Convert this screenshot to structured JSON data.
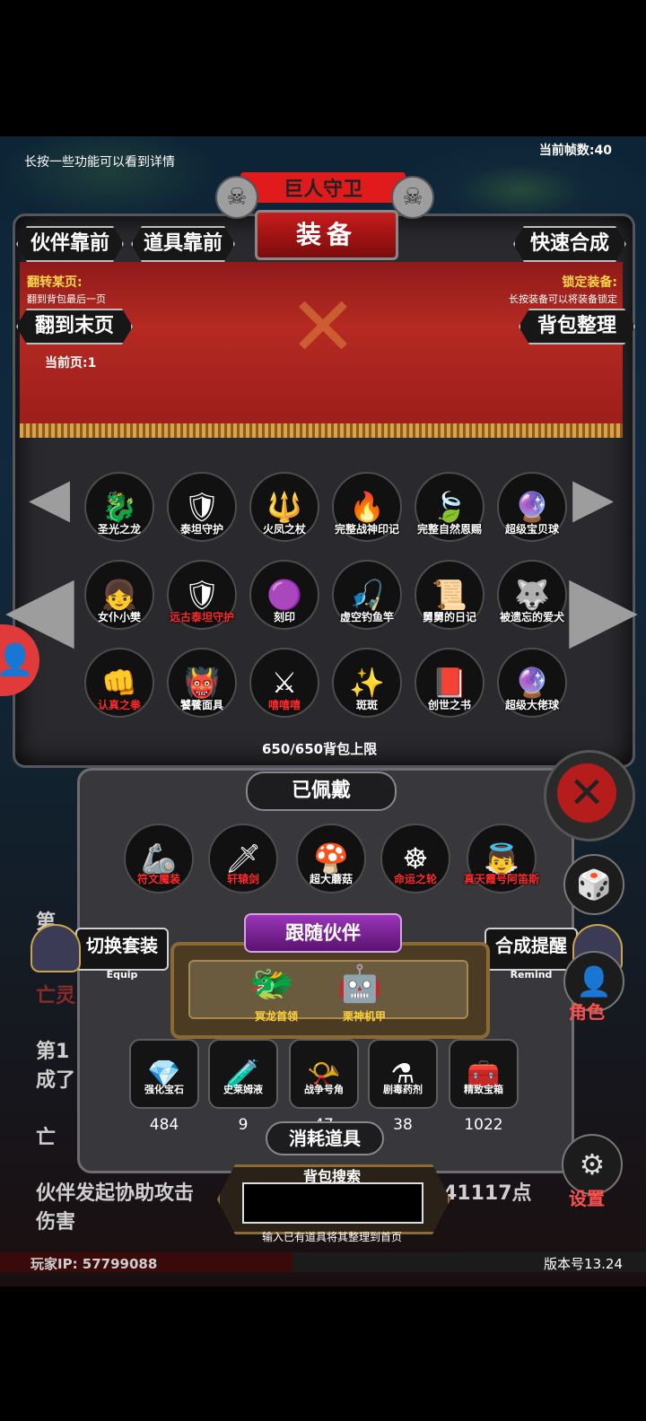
{
  "hint": "长按一些功能可以看到详情",
  "fps": "当前帧数:40",
  "title_top": "巨人守卫",
  "title_main": "装备",
  "buttons": {
    "partner_front": "伙伴靠前",
    "item_front": "道具靠前",
    "quick_synth": "快速合成",
    "last_page": "翻到末页",
    "bag_sort": "背包整理"
  },
  "flip": {
    "title": "翻转某页:",
    "desc": "翻到背包最后一页"
  },
  "lock": {
    "title": "锁定装备:",
    "desc": "长按装备可以将装备锁定"
  },
  "current_page": "当前页:1",
  "items": [
    {
      "name": "圣光之龙",
      "icon": "🐉",
      "color": "white"
    },
    {
      "name": "泰坦守护",
      "icon": "🛡",
      "color": "white"
    },
    {
      "name": "火凤之杖",
      "icon": "🔱",
      "color": "white"
    },
    {
      "name": "完整战神印记",
      "icon": "🔥",
      "color": "white"
    },
    {
      "name": "完整自然恩赐",
      "icon": "🍃",
      "color": "white"
    },
    {
      "name": "超级宝贝球",
      "icon": "🔮",
      "color": "white"
    },
    {
      "name": "女仆小樊",
      "icon": "👧",
      "color": "white"
    },
    {
      "name": "远古泰坦守护",
      "icon": "🛡",
      "color": "red"
    },
    {
      "name": "刻印",
      "icon": "🟣",
      "color": "white"
    },
    {
      "name": "虚空钓鱼竿",
      "icon": "🎣",
      "color": "white"
    },
    {
      "name": "舅舅的日记",
      "icon": "📜",
      "color": "white"
    },
    {
      "name": "被遗忘的爱犬",
      "icon": "🐺",
      "color": "white"
    },
    {
      "name": "认真之拳",
      "icon": "👊",
      "color": "red"
    },
    {
      "name": "饕餮面具",
      "icon": "👹",
      "color": "white"
    },
    {
      "name": "嘻嘻嘻",
      "icon": "⚔",
      "color": "red"
    },
    {
      "name": "斑斑",
      "icon": "✨",
      "color": "white"
    },
    {
      "name": "创世之书",
      "icon": "📕",
      "color": "white"
    },
    {
      "name": "超级大佬球",
      "icon": "🔮",
      "color": "white"
    }
  ],
  "capacity": "650/650背包上限",
  "equipped_title": "已佩戴",
  "equipped": [
    {
      "name": "符文魔装",
      "icon": "🦾",
      "color": "red"
    },
    {
      "name": "轩辕剑",
      "icon": "🗡",
      "color": "red"
    },
    {
      "name": "超大蘑菇",
      "icon": "🍄",
      "color": "white"
    },
    {
      "name": "命运之轮",
      "icon": "☸",
      "color": "red"
    },
    {
      "name": "真天霞号阿笛斯",
      "icon": "👼",
      "color": "red"
    }
  ],
  "switch_set": {
    "label": "切换套装",
    "sub": "Equip"
  },
  "synth_remind": {
    "label": "合成提醒",
    "sub": "Remind"
  },
  "companion_title": "跟随伙伴",
  "companions": [
    {
      "name": "冥龙首领",
      "icon": "🐲"
    },
    {
      "name": "栗神机甲",
      "icon": "🤖"
    }
  ],
  "consumables": [
    {
      "name": "强化宝石",
      "count": "484",
      "icon": "💎"
    },
    {
      "name": "史莱姆液",
      "count": "9",
      "icon": "🧪"
    },
    {
      "name": "战争号角",
      "count": "47",
      "icon": "📯"
    },
    {
      "name": "剧毒药剂",
      "count": "38",
      "icon": "⚗"
    },
    {
      "name": "精致宝箱",
      "count": "1022",
      "icon": "🧰"
    }
  ],
  "consumables_title": "消耗道具",
  "search": {
    "title": "背包搜索",
    "hint": "输入已有道具将其整理到首页",
    "value": ""
  },
  "log_lines": [
    "第",
    "亡灵",
    "第1",
    "成了",
    "亡",
    "伙伴发起协助攻击",
    "41117点",
    "伤害"
  ],
  "right_labels": {
    "role": "角色",
    "settings": "设置",
    "hidden": "背"
  },
  "player_ip": "玩家IP: 57799088",
  "version": "版本号13.24"
}
